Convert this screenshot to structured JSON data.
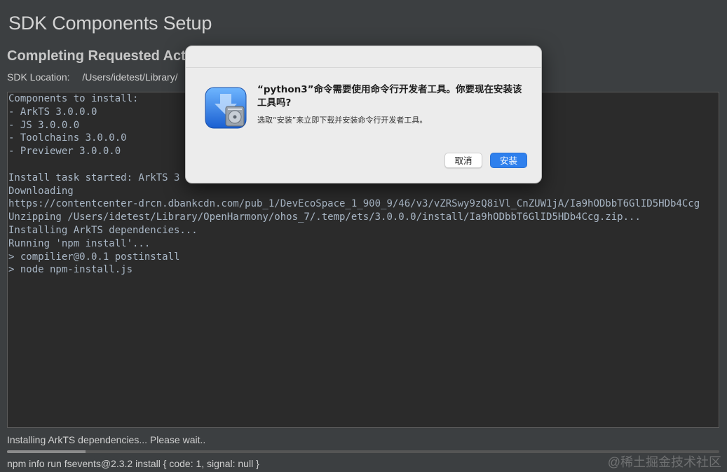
{
  "window": {
    "title": "SDK Components Setup",
    "section_title": "Completing Requested Act",
    "sdk_location_label": "SDK Location:",
    "sdk_location_path": "/Users/idetest/Library/"
  },
  "log": {
    "lines": [
      "Components to install:",
      "- ArkTS 3.0.0.0",
      "- JS 3.0.0.0",
      "- Toolchains 3.0.0.0",
      "- Previewer 3.0.0.0",
      "",
      "Install task started: ArkTS 3",
      "Downloading",
      "https://contentcenter-drcn.dbankcdn.com/pub_1/DevEcoSpace_1_900_9/46/v3/vZRSwy9zQ8iVl_CnZUW1jA/Ia9hODbbT6GlID5HDb4Ccg",
      "Unzipping /Users/idetest/Library/OpenHarmony/ohos_7/.temp/ets/3.0.0.0/install/Ia9hODbbT6GlID5HDb4Ccg.zip...",
      "Installing ArkTS dependencies...",
      "Running 'npm install'...",
      "> compilier@0.0.1 postinstall",
      "> node npm-install.js"
    ]
  },
  "status": {
    "text": "Installing ArkTS dependencies... Please wait..",
    "progress_percent": 11,
    "npm_info": "npm info run fsevents@2.3.2 install { code: 1, signal: null }"
  },
  "watermark": "@稀土掘金技术社区",
  "dialog": {
    "message": "“python3”命令需要使用命令行开发者工具。你要现在安装该工具吗?",
    "info": "选取“安装”来立即下载并安装命令行开发者工具。",
    "cancel_label": "取消",
    "install_label": "安装",
    "icon": "xcode-installer-icon",
    "accent_color": "#2f80ed"
  }
}
